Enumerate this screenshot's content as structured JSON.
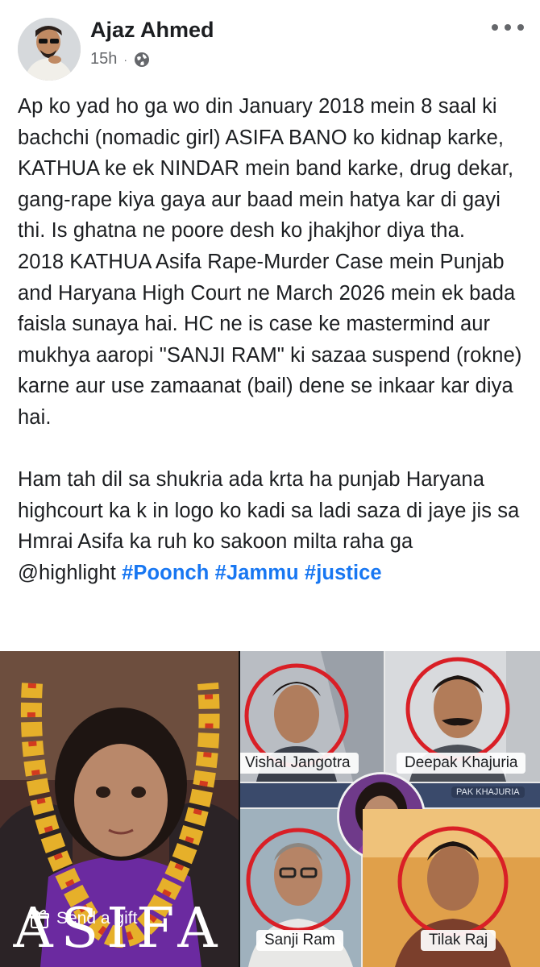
{
  "post": {
    "author": "Ajaz Ahmed",
    "time": "15h",
    "separator": "·",
    "privacy_icon": "globe-icon",
    "more_icon": "more-icon",
    "paragraph1": "Ap ko yad ho ga wo din  January 2018 mein 8 saal ki bachchi (nomadic girl) ASIFA BANO ko kidnap karke, KATHUA ke ek NINDAR mein band karke, drug dekar, gang-rape kiya gaya aur baad mein hatya kar di gayi thi. Is ghatna ne poore desh ko jhakjhor diya tha.",
    "paragraph2": "2018 KATHUA Asifa  Rape-Murder Case mein Punjab and Haryana High Court ne March 2026 mein ek bada faisla sunaya hai. HC ne is case ke mastermind aur mukhya aaropi \"SANJI RAM\"  ki sazaa suspend (rokne) karne aur use zamaanat (bail) dene se inkaar kar diya hai.",
    "paragraph3": "Ham tah dil sa shukria ada krta ha punjab Haryana highcourt ka k in logo ko kadi sa ladi saza di jaye jis sa  Hmrai Asifa ka ruh ko sakoon milta raha ga",
    "mention": "@highlight",
    "hashtags": [
      "#Poonch",
      "#Jammu",
      "#justice"
    ]
  },
  "image": {
    "main_caption": "ASIFA",
    "labels": [
      "Vishal Jangotra",
      "Deepak Khajuria",
      "Sanji Ram",
      "Tilak Raj"
    ],
    "badge_text": "PAK KHAJURIA",
    "ring_color": "#d91f26"
  },
  "send_gift": {
    "label": "Send a gift",
    "icon": "gift-icon"
  },
  "colors": {
    "hashtag": "#1877f2",
    "meta": "#65676b",
    "text": "#1c1e21"
  }
}
